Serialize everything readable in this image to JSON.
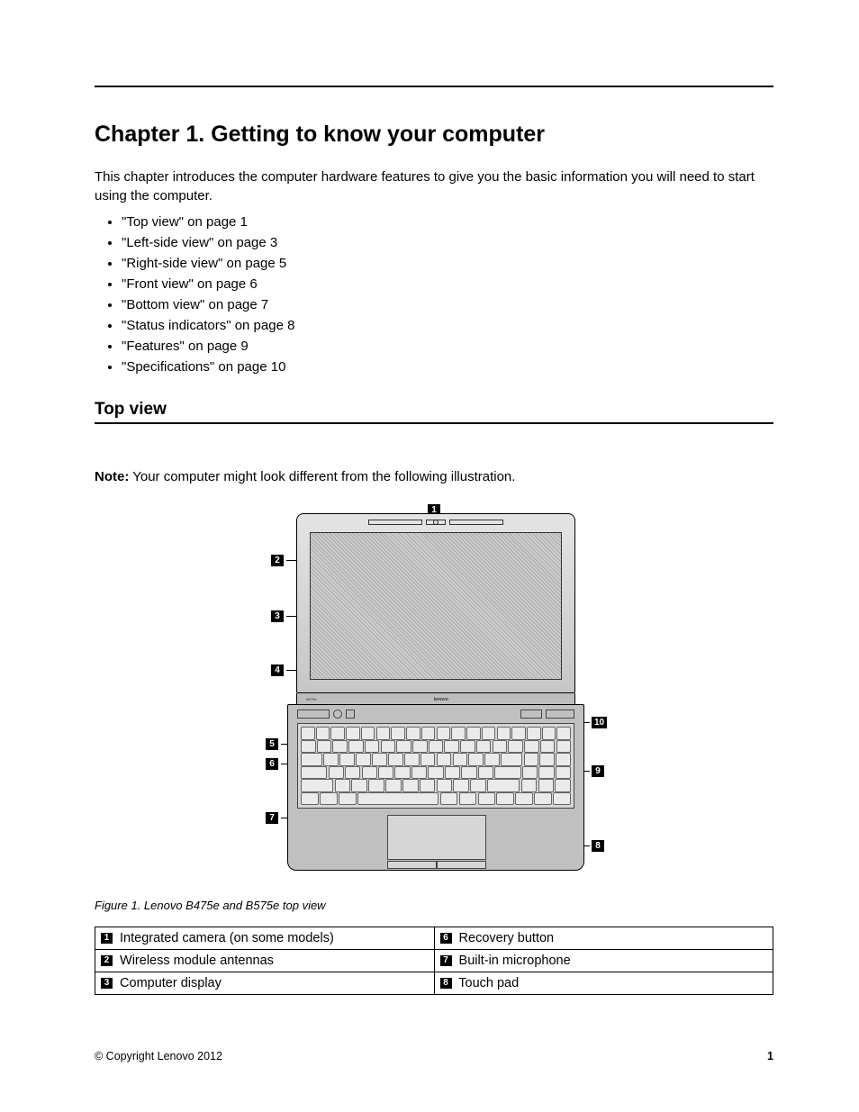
{
  "chapter_heading": "Chapter 1.  Getting to know your computer",
  "intro_text": "This chapter introduces the computer hardware features to give you the basic information you will need to start using the computer.",
  "toc": [
    "\"Top view\" on page 1",
    "\"Left-side view\" on page 3",
    "\"Right-side view\" on page 5",
    "\"Front view\" on page 6",
    "\"Bottom view\" on page 7",
    "\"Status indicators\" on page 8",
    "\"Features\" on page 9",
    "\"Specifications\" on page 10"
  ],
  "section_heading": "Top view",
  "note_label": "Note:",
  "note_text": " Your computer might look different from the following illustration.",
  "figure_caption": "Figure 1.  Lenovo B475e and B575e top view",
  "brand_lid": "lenovo",
  "hinge_left": "B575e",
  "callouts": {
    "c1": "1",
    "c2": "2",
    "c3": "3",
    "c4": "4",
    "c5": "5",
    "c6": "6",
    "c7": "7",
    "c8": "8",
    "c9": "9",
    "c10": "10"
  },
  "parts_table": [
    {
      "left_num": "1",
      "left_label": " Integrated camera (on some models)",
      "right_num": "6",
      "right_label": " Recovery button"
    },
    {
      "left_num": "2",
      "left_label": " Wireless module antennas",
      "right_num": "7",
      "right_label": " Built-in microphone"
    },
    {
      "left_num": "3",
      "left_label": " Computer display",
      "right_num": "8",
      "right_label": " Touch pad"
    }
  ],
  "footer": {
    "copyright": "© Copyright Lenovo 2012",
    "page_number": "1"
  }
}
